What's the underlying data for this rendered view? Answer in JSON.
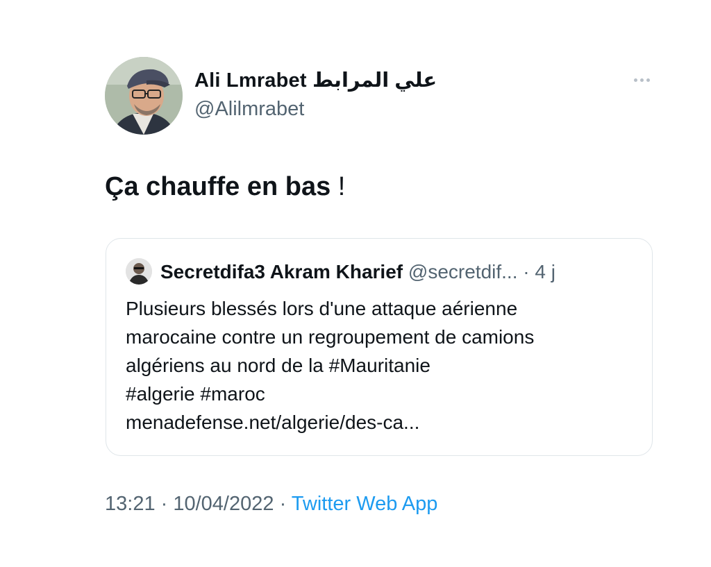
{
  "author": {
    "display_name": "Ali Lmrabet علي المرابط",
    "handle": "@Alilmrabet"
  },
  "tweet": {
    "text_main": "Ça chauffe en bas",
    "text_end": " !"
  },
  "quoted_tweet": {
    "name": "Secretdifa3 Akram Kharief",
    "handle": "@secretdif...",
    "separator": " · ",
    "time": "4 j",
    "lines": [
      "Plusieurs blessés lors d'une attaque aérienne",
      "marocaine contre un regroupement de camions",
      "algériens au nord de la #Mauritanie",
      "#algerie #maroc",
      "menadefense.net/algerie/des-ca..."
    ]
  },
  "meta": {
    "time": "13:21",
    "separator1": " · ",
    "date": "10/04/2022",
    "separator2": " · ",
    "source": "Twitter Web App"
  },
  "icons": {
    "more": "more-horizontal-icon"
  },
  "colors": {
    "text": "#0f1419",
    "secondary": "#536471",
    "link": "#1d9bf0",
    "border": "#dfe5e9"
  }
}
